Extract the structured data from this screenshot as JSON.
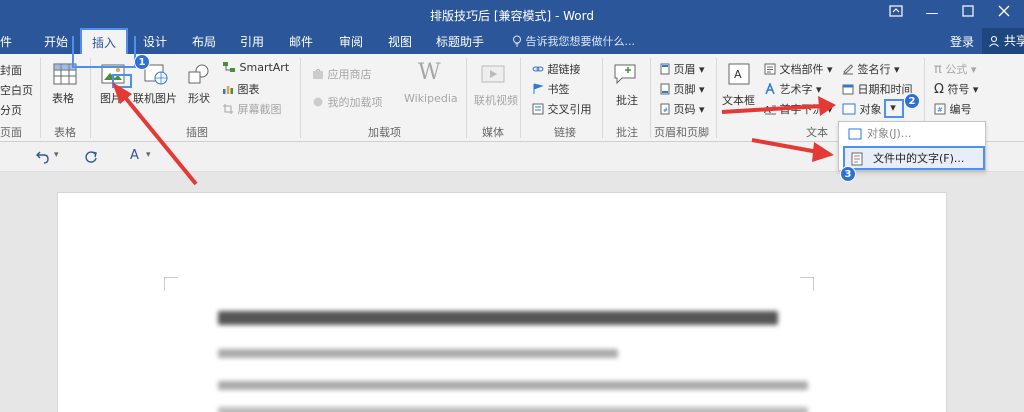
{
  "window": {
    "title": "排版技巧后 [兼容模式] - Word",
    "help_icon": "ribbon-display-icon",
    "minimize": "—"
  },
  "tabs": {
    "file": "件",
    "home": "开始",
    "insert": "插入",
    "design": "设计",
    "layout": "布局",
    "references": "引用",
    "mailings": "邮件",
    "review": "审阅",
    "view": "视图",
    "helper": "标题助手",
    "tell_me": "告诉我您想要做什么...",
    "login": "登录",
    "share": "共享"
  },
  "ribbon": {
    "pages": {
      "cover": "封面",
      "blank": "空白页",
      "break": "分页",
      "group": "页面"
    },
    "tables": {
      "table": "表格",
      "group": "表格"
    },
    "illustrations": {
      "picture": "图片",
      "online_picture": "联机图片",
      "shapes": "形状",
      "smartart": "SmartArt",
      "chart": "图表",
      "screenshot": "屏幕截图",
      "group": "插图"
    },
    "addins": {
      "store": "应用商店",
      "my_addins": "我的加载项",
      "wikipedia": "Wikipedia",
      "group": "加载项"
    },
    "media": {
      "online_video": "联机视频",
      "group": "媒体"
    },
    "links": {
      "hyperlink": "超链接",
      "bookmark": "书签",
      "cross_ref": "交叉引用",
      "group": "链接"
    },
    "comments": {
      "comment": "批注",
      "group": "批注"
    },
    "header_footer": {
      "header": "页眉",
      "footer": "页脚",
      "page_number": "页码",
      "group": "页眉和页脚"
    },
    "text": {
      "textbox": "文本框",
      "quick_parts": "文档部件",
      "wordart": "艺术字",
      "drop_cap": "首字下沉",
      "signature": "签名行",
      "datetime": "日期和时间",
      "object": "对象",
      "group": "文本"
    },
    "symbols": {
      "equation": "公式",
      "symbol": "符号",
      "number": "编号"
    }
  },
  "dropdown": {
    "object": "对象(J)...",
    "text_from_file": "文件中的文字(F)..."
  },
  "badges": [
    "1",
    "2",
    "3"
  ],
  "colors": {
    "titlebar": "#2b579a",
    "highlight": "#4e8ff2",
    "arrow": "#e53935"
  }
}
